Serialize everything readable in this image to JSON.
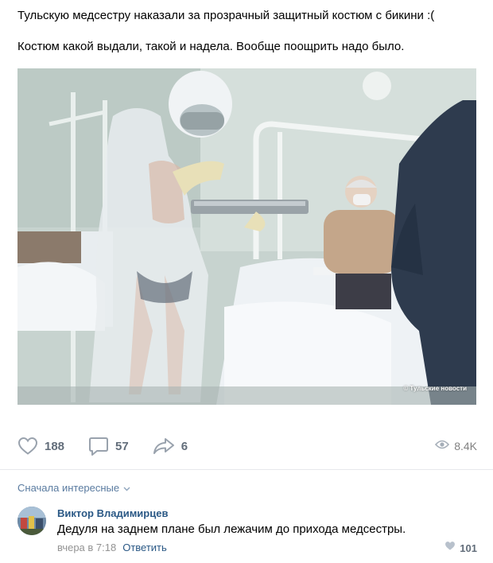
{
  "post": {
    "line1": "Тульскую медсестру наказали за прозрачный защитный костюм с бикини :(",
    "line2": "Костюм какой выдали, такой и надела. Вообще поощрить надо было.",
    "photo_watermark": "© Тульские новости"
  },
  "actions": {
    "likes": "188",
    "comments": "57",
    "shares": "6",
    "views": "8.4K"
  },
  "comments_section": {
    "sort_label": "Сначала интересные",
    "items": [
      {
        "author": "Виктор Владимирцев",
        "text": "Дедуля на заднем плане был лежачим до прихода медсестры.",
        "time": "вчера в 7:18",
        "reply_label": "Ответить",
        "likes": "101"
      }
    ]
  },
  "colors": {
    "link": "#2a5885",
    "sort_link": "#5a7ba0",
    "action_icon": "#99a2ad",
    "action_count": "#626d7a",
    "muted": "#939393",
    "divider": "#e7e8ec"
  },
  "icons": {
    "like": "heart-icon",
    "comment": "speech-bubble-icon",
    "share": "share-arrow-icon",
    "views": "eye-icon",
    "sort": "chevron-down-icon"
  }
}
